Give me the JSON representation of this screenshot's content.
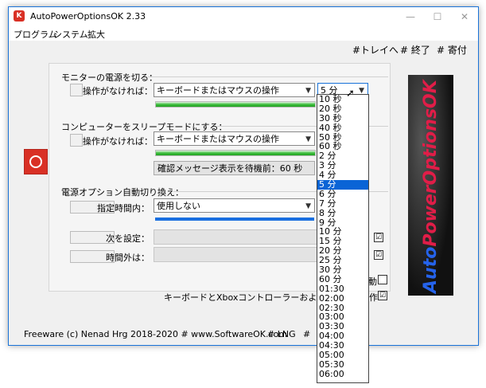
{
  "window": {
    "title": "AutoPowerOptionsOK 2.33",
    "min": "—",
    "max": "☐",
    "close": "✕"
  },
  "menu": [
    "プログラム",
    "システム",
    "拡大"
  ],
  "toplinks": [
    "#トレイへ",
    "# 終了",
    "# 寄付"
  ],
  "monitor": {
    "section": "モニターの電源を切る：",
    "label": "操作がなければ：",
    "combo": "キーボードまたはマウスの操作",
    "time": "5 分"
  },
  "sleep": {
    "section": "コンピューターをスリープモードにする：",
    "label": "操作がなければ：",
    "combo": "キーボードまたはマウスの操作",
    "confirm": "確認メッセージ表示を待機前：60 秒"
  },
  "power": {
    "section": "電源オプション自動切り換え：",
    "label_time": "指定時間内：",
    "combo": "使用しない",
    "label_next": "次を設定：",
    "label_outside": "時間外は：",
    "check1": "☑",
    "check2": "☑"
  },
  "extra": {
    "frag1": "動",
    "frag2": "キーボードとXboxコントローラーおよびジョイ",
    "frag3": "作"
  },
  "logo": {
    "part1": "Auto",
    "part2": "PowerOptionsOK"
  },
  "footer": {
    "copyright": "Freeware (c) Nenad Hrg 2018-2020 # www.SoftwareOK.com",
    "lng": "# LNG",
    "hash": "#"
  },
  "dropdown": {
    "items": [
      "10 秒",
      "20 秒",
      "30 秒",
      "40 秒",
      "50 秒",
      "60 秒",
      "2 分",
      "3 分",
      "4 分",
      "5 分",
      "6 分",
      "7 分",
      "8 分",
      "9 分",
      "10 分",
      "15 分",
      "20 分",
      "25 分",
      "30 分",
      "60 分",
      "01:30",
      "02:00",
      "02:30",
      "03:00",
      "03:30",
      "04:00",
      "04:30",
      "05:00",
      "05:30",
      "06:00"
    ],
    "selected": "5 分"
  }
}
